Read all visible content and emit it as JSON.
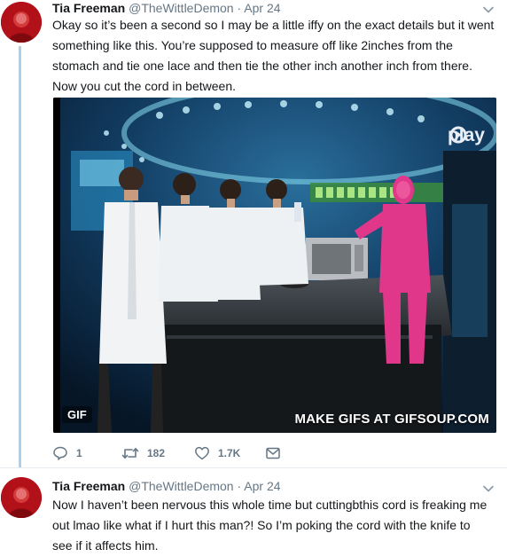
{
  "tweets": [
    {
      "author_name": "Tia Freeman",
      "handle": "@TheWittleDemon",
      "separator": "·",
      "time": "Apr 24",
      "text_lines": [
        "Okay so it’s been a second so I may be a little iffy on the exact details but it went",
        "something like this. You’re supposed to measure off like 2inches from the",
        "stomach and tie one lace and then tie the other inch another inch from there.",
        "Now you cut the cord in between."
      ],
      "media": {
        "badge": "GIF",
        "watermark": "MAKE GIFS AT GIFSOUP.COM",
        "brand": "play"
      },
      "actions": {
        "reply_icon": "reply-icon",
        "reply_count": "1",
        "retweet_icon": "retweet-icon",
        "retweet_count": "182",
        "like_icon": "heart-icon",
        "like_count": "1.7K",
        "dm_icon": "envelope-icon"
      }
    },
    {
      "author_name": "Tia Freeman",
      "handle": "@TheWittleDemon",
      "separator": "·",
      "time": "Apr 24",
      "text_lines": [
        "Now I haven’t been nervous this whole time but cuttingbthis cord is freaking me",
        "out lmao like what if I hurt this man?! So I’m poking the cord with the knife to",
        "see if it affects him."
      ]
    }
  ],
  "colors": {
    "thread_line": "#aad0ec",
    "secondary_text": "#657786",
    "avatar_bg": "#b2111a"
  }
}
